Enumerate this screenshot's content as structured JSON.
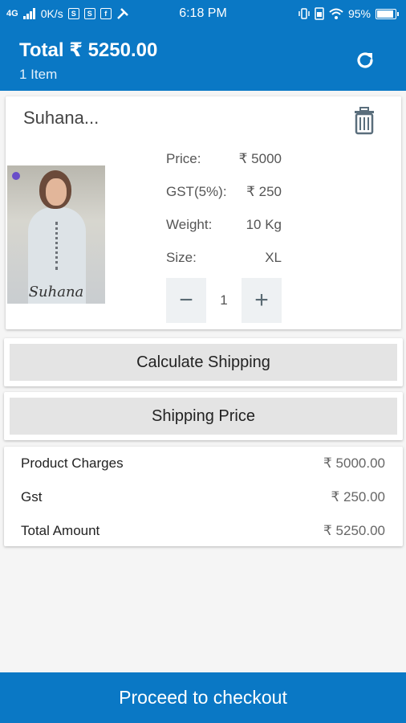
{
  "status_bar": {
    "network": "4G",
    "speed": "0K/s",
    "time": "6:18 PM",
    "battery": "95%"
  },
  "header": {
    "total": "Total ₹ 5250.00",
    "item_count": "1 Item",
    "refresh_icon": "refresh-icon"
  },
  "product": {
    "name": "Suhana...",
    "image_caption": "Suhana",
    "delete_icon": "trash-icon",
    "details": [
      {
        "label": "Price:",
        "value": "₹ 5000"
      },
      {
        "label": "GST(5%):",
        "value": "₹ 250"
      },
      {
        "label": "Weight:",
        "value": "10 Kg"
      },
      {
        "label": "Size:",
        "value": "XL"
      }
    ],
    "quantity": "1",
    "decrement_label": "−",
    "increment_label": "+"
  },
  "actions": {
    "calculate_shipping": "Calculate Shipping",
    "shipping_price": "Shipping Price"
  },
  "summary": [
    {
      "label": "Product Charges",
      "value": "₹ 5000.00"
    },
    {
      "label": "Gst",
      "value": "₹ 250.00"
    },
    {
      "label": "Total Amount",
      "value": "₹ 5250.00"
    }
  ],
  "checkout": {
    "label": "Proceed to checkout"
  },
  "colors": {
    "primary": "#0a78c5",
    "button_gray": "#e4e4e4",
    "stepper_bg": "#eef1f3"
  }
}
